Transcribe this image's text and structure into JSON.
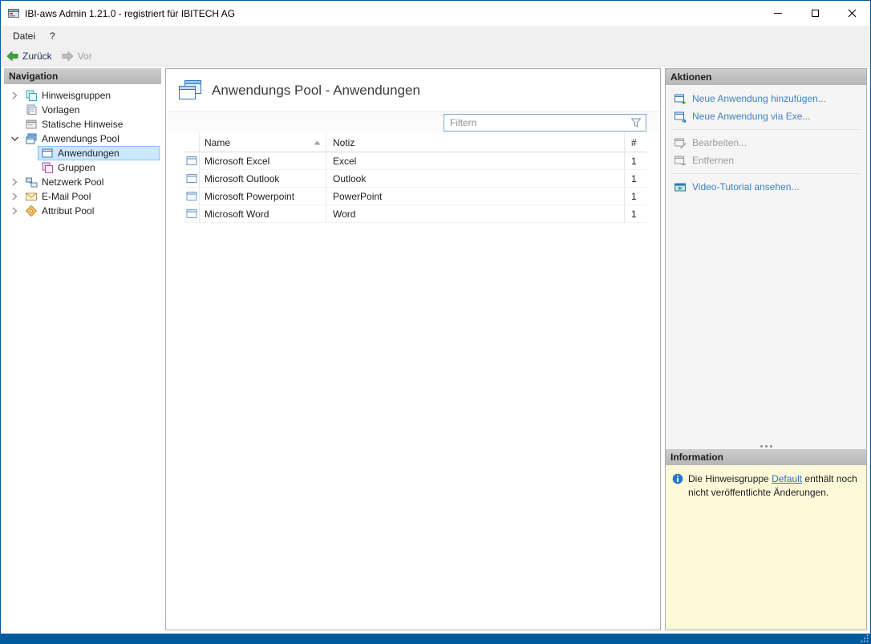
{
  "window": {
    "title": "IBI-aws Admin 1.21.0 - registriert für IBITECH AG",
    "controls": [
      {
        "name": "minimize"
      },
      {
        "name": "maximize"
      },
      {
        "name": "close"
      }
    ]
  },
  "menu": {
    "items": [
      {
        "label": "Datei"
      },
      {
        "label": "?"
      }
    ]
  },
  "toolbar": {
    "back_label": "Zurück",
    "forward_label": "Vor"
  },
  "navigation": {
    "header": "Navigation",
    "items": [
      {
        "label": "Hinweisgruppen",
        "depth": 0,
        "state": "collapsed",
        "icon": "hinweisgruppen-icon"
      },
      {
        "label": "Vorlagen",
        "depth": 0,
        "state": "leaf",
        "icon": "vorlagen-icon"
      },
      {
        "label": "Statische Hinweise",
        "depth": 0,
        "state": "leaf",
        "icon": "statische-hinweise-icon"
      },
      {
        "label": "Anwendungs Pool",
        "depth": 0,
        "state": "expanded",
        "icon": "anwendungs-pool-icon"
      },
      {
        "label": "Anwendungen",
        "depth": 1,
        "state": "leaf",
        "selected": true,
        "icon": "anwendung-icon"
      },
      {
        "label": "Gruppen",
        "depth": 1,
        "state": "leaf",
        "icon": "gruppen-icon"
      },
      {
        "label": "Netzwerk Pool",
        "depth": 0,
        "state": "collapsed",
        "icon": "netzwerk-pool-icon"
      },
      {
        "label": "E-Mail Pool",
        "depth": 0,
        "state": "collapsed",
        "icon": "email-pool-icon"
      },
      {
        "label": "Attribut Pool",
        "depth": 0,
        "state": "collapsed",
        "icon": "attribut-pool-icon"
      }
    ]
  },
  "main": {
    "title": "Anwendungs Pool - Anwendungen",
    "filter_placeholder": "Filtern",
    "table": {
      "columns": [
        "Name",
        "Notiz",
        "#"
      ],
      "sort": {
        "column": "Name",
        "direction": "ascending"
      },
      "rows": [
        {
          "name": "Microsoft Excel",
          "notiz": "Excel",
          "count": "1"
        },
        {
          "name": "Microsoft Outlook",
          "notiz": "Outlook",
          "count": "1"
        },
        {
          "name": "Microsoft Powerpoint",
          "notiz": "PowerPoint",
          "count": "1"
        },
        {
          "name": "Microsoft Word",
          "notiz": "Word",
          "count": "1"
        }
      ]
    }
  },
  "actions": {
    "header": "Aktionen",
    "items": [
      {
        "label": "Neue Anwendung hinzufügen...",
        "enabled": true,
        "icon": "new-application-icon"
      },
      {
        "label": "Neue Anwendung via Exe...",
        "enabled": true,
        "icon": "new-application-exe-icon"
      },
      {
        "label": "Bearbeiten...",
        "enabled": false,
        "icon": "edit-icon"
      },
      {
        "label": "Entfernen",
        "enabled": false,
        "icon": "remove-icon"
      },
      {
        "label": "Video-Tutorial ansehen...",
        "enabled": true,
        "icon": "video-tutorial-icon"
      }
    ]
  },
  "information": {
    "header": "Information",
    "text_before": "Die Hinweisgruppe ",
    "link_label": "Default",
    "text_after": " enthält noch nicht veröffentlichte Änderungen."
  },
  "colors": {
    "accent_border": "#005a9e",
    "selection_bg": "#cce8ff",
    "selection_border": "#84c1ff",
    "link_blue": "#3e82c4",
    "disabled_gray": "#9b9b9b",
    "info_bg": "#fdf9d8",
    "panel_header_gray": "#bfbfbf"
  }
}
